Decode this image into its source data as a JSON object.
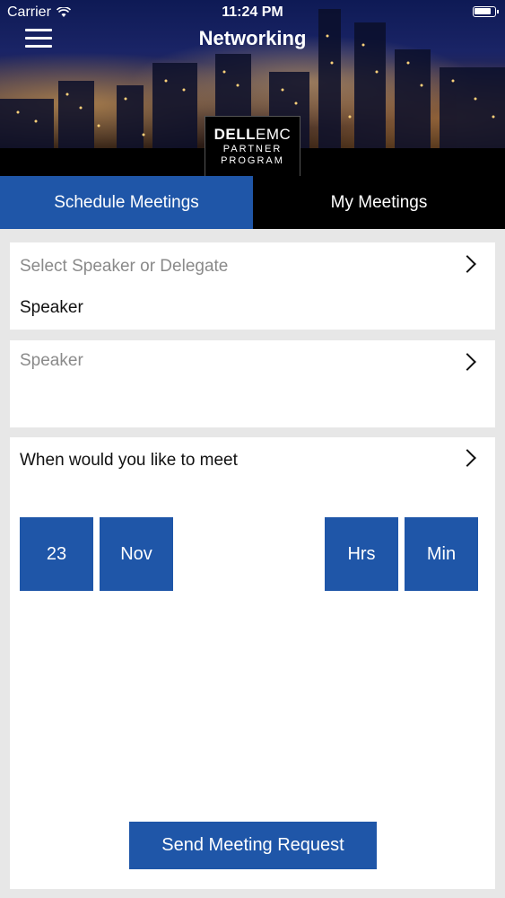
{
  "status_bar": {
    "carrier": "Carrier",
    "time": "11:24 PM"
  },
  "header": {
    "title": "Networking",
    "menu_icon": "hamburger-menu-icon",
    "logo": {
      "brand_bold": "DELL",
      "brand_light": "EMC",
      "line1": "PARTNER",
      "line2": "PROGRAM"
    }
  },
  "tabs": [
    {
      "label": "Schedule Meetings",
      "active": true
    },
    {
      "label": "My Meetings",
      "active": false
    }
  ],
  "select_card": {
    "placeholder": "Select Speaker or Delegate",
    "value": "Speaker"
  },
  "person_card": {
    "placeholder": "Speaker"
  },
  "meet_card": {
    "title": "When would you like to meet",
    "day": "23",
    "month": "Nov",
    "hours": "Hrs",
    "minutes": "Min",
    "send_label": "Send Meeting Request"
  },
  "colors": {
    "accent": "#1f56a8",
    "background": "#e7e7e7",
    "header_bg": "#000000"
  }
}
